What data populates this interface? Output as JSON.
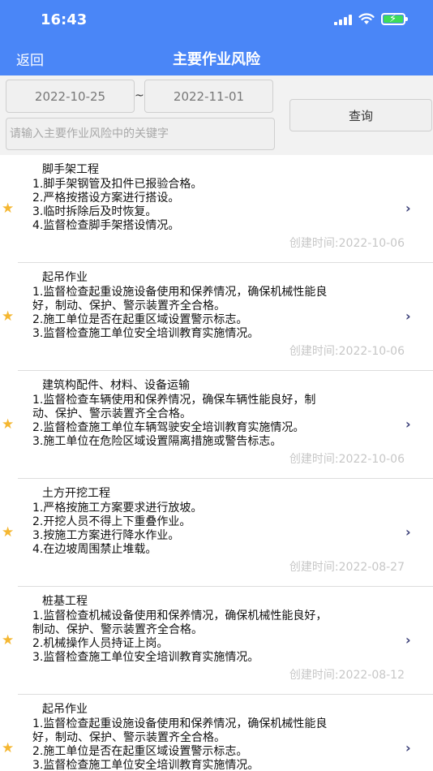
{
  "status_bar": {
    "time": "16:43"
  },
  "header": {
    "back_label": "返回",
    "title": "主要作业风险"
  },
  "filter": {
    "start_date": "2022-10-25",
    "separator": "~",
    "end_date": "2022-11-01",
    "search_placeholder": "请输入主要作业风险中的关键字",
    "query_label": "查询"
  },
  "icons": {
    "favorite": "star-icon",
    "navigate": "chevron-right-icon"
  },
  "colors": {
    "accent": "#4a86f7",
    "star": "#f5b731",
    "chevron": "#3a3f78",
    "date_text": "#c7c7c7"
  },
  "items": [
    {
      "title": "脚手架工程",
      "lines": [
        "1.脚手架钢管及扣件已报验合格。",
        "2.严格按搭设方案进行搭设。",
        "3.临时拆除后及时恢复。",
        "4.监督检查脚手架搭设情况。"
      ],
      "date": "创建时间:2022-10-06"
    },
    {
      "title": "起吊作业",
      "lines": [
        "1.监督检查起重设施设备使用和保养情况，确保机械性能良",
        "好，制动、保护、警示装置齐全合格。",
        "2.施工单位是否在起重区域设置警示标志。",
        "3.监督检查施工单位安全培训教育实施情况。"
      ],
      "date": "创建时间:2022-10-06"
    },
    {
      "title": "建筑构配件、材料、设备运输",
      "lines": [
        "1.监督检查车辆使用和保养情况，确保车辆性能良好，制",
        "动、保护、警示装置齐全合格。",
        "2.监督检查施工单位车辆驾驶安全培训教育实施情况。",
        "3.施工单位在危险区域设置隔离措施或警告标志。"
      ],
      "date": "创建时间:2022-10-06"
    },
    {
      "title": "土方开挖工程",
      "lines": [
        "1.严格按施工方案要求进行放坡。",
        "2.开挖人员不得上下重叠作业。",
        "3.按施工方案进行降水作业。",
        "4.在边坡周围禁止堆载。"
      ],
      "date": "创建时间:2022-08-27"
    },
    {
      "title": "桩基工程",
      "lines": [
        "1.监督检查机械设备使用和保养情况，确保机械性能良好，",
        "制动、保护、警示装置齐全合格。",
        "2.机械操作人员持证上岗。",
        "3.监督检查施工单位安全培训教育实施情况。"
      ],
      "date": "创建时间:2022-08-12"
    },
    {
      "title": "起吊作业",
      "lines": [
        "1.监督检查起重设施设备使用和保养情况，确保机械性能良",
        "好，制动、保护、警示装置齐全合格。",
        "2.施工单位是否在起重区域设置警示标志。",
        "3.监督检查施工单位安全培训教育实施情况。"
      ],
      "date": ""
    }
  ]
}
